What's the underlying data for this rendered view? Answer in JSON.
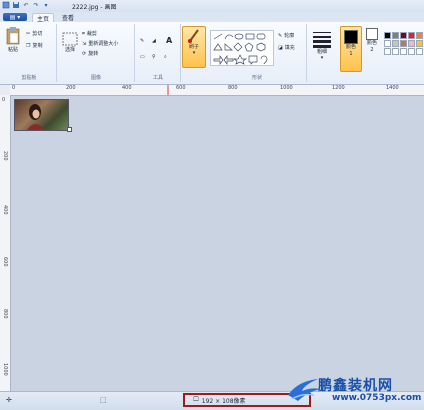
{
  "window": {
    "title": "2222.jpg - 画图"
  },
  "tabs": {
    "menu_label": "▤ ▾",
    "home": "主页",
    "view": "查看"
  },
  "ribbon": {
    "clipboard": {
      "paste": "粘贴",
      "cut": "剪切",
      "copy": "复制",
      "label": "剪贴板"
    },
    "image": {
      "select": "选择",
      "crop": "裁剪",
      "resize": "重新调整大小",
      "rotate": "旋转",
      "label": "图像"
    },
    "tools": {
      "label": "工具"
    },
    "brushes": {
      "label": "刷子"
    },
    "shapes": {
      "outline": "轮廓",
      "fill": "填充",
      "label": "形状"
    },
    "size": {
      "label": "粗细"
    },
    "color1": {
      "label": "颜色 1"
    },
    "color2": {
      "label": "颜色 2"
    },
    "palette": [
      "#000000",
      "#7f7f7f",
      "#880015",
      "#ed1c24",
      "#ff7f27",
      "#ffffff",
      "#c3c3c3",
      "#b97a57",
      "#ffaec9",
      "#ffc90e",
      "#ffffff",
      "#ffffff",
      "#ffffff",
      "#ffffff",
      "#ffffff"
    ]
  },
  "ruler_h": [
    "0",
    "200",
    "400",
    "600",
    "800",
    "1000",
    "1200",
    "1400"
  ],
  "ruler_v": [
    "0",
    "200",
    "400",
    "600",
    "800",
    "1000"
  ],
  "status": {
    "dimensions": "192 × 108像素"
  },
  "watermark": {
    "title": "鹏鑫装机网",
    "url": "www.0753px.com"
  }
}
